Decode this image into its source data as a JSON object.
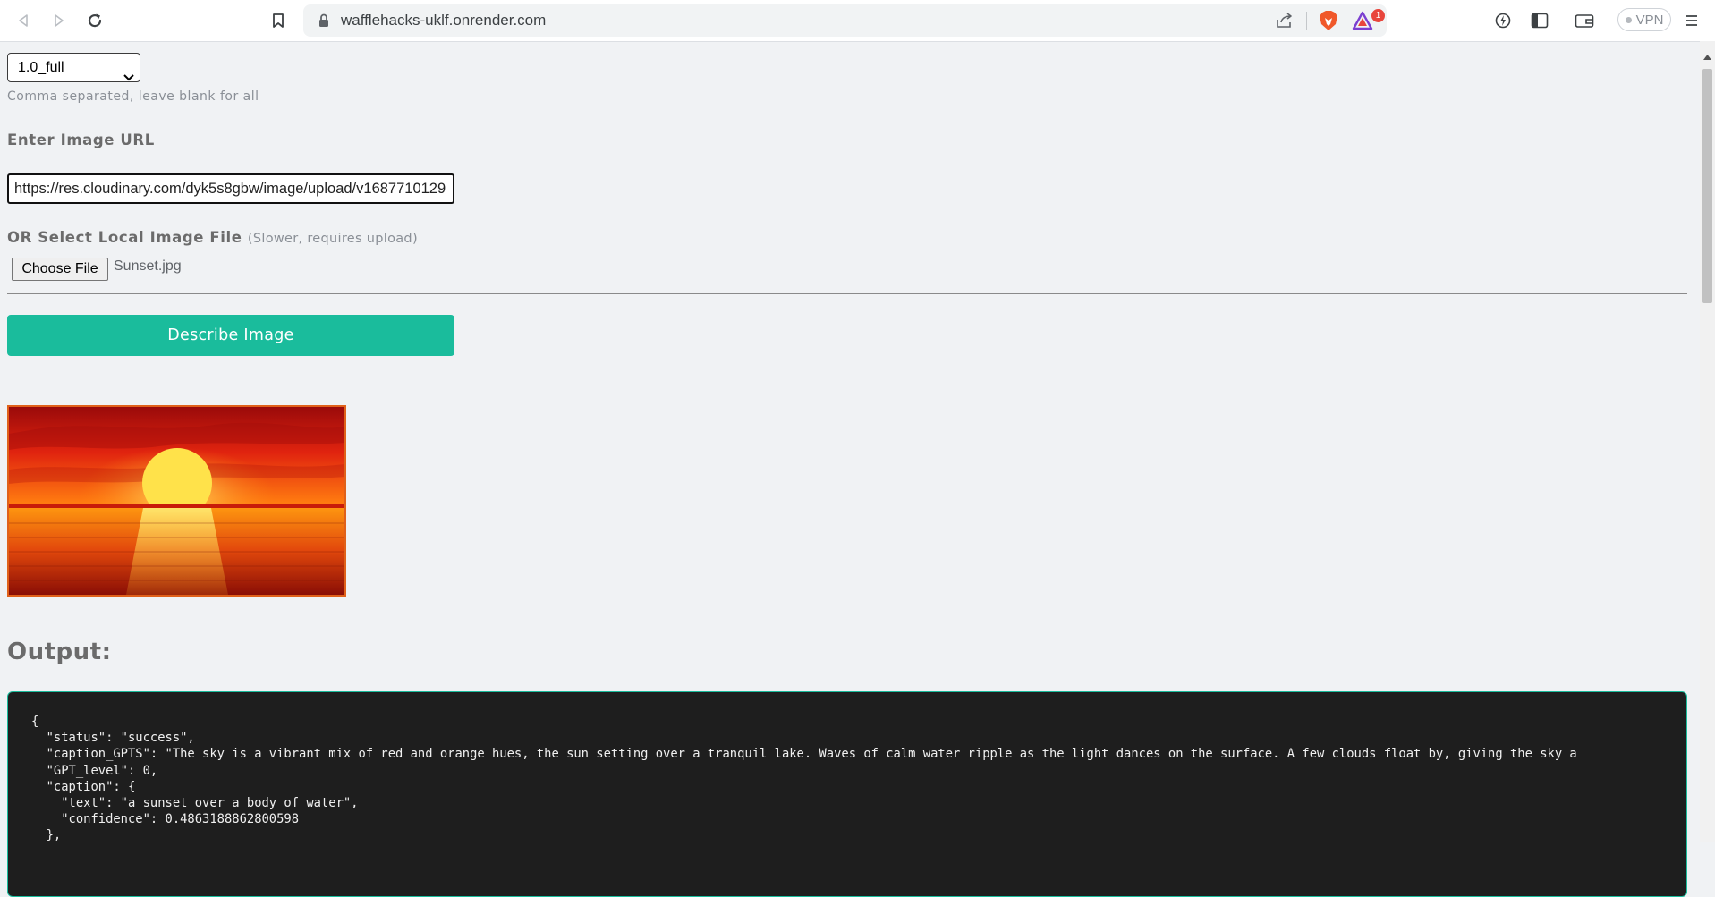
{
  "browser": {
    "url": "wafflehacks-uklf.onrender.com",
    "notification_count": "1",
    "vpn_label": "VPN"
  },
  "form": {
    "model_select_value": "1.0_full",
    "model_hint": "Comma separated, leave blank for all",
    "image_url_label": "Enter Image URL",
    "image_url_value": "https://res.cloudinary.com/dyk5s8gbw/image/upload/v1687710129",
    "local_file_label": "OR Select Local Image File",
    "local_file_note": "(Slower, requires upload)",
    "choose_file_label": "Choose File",
    "file_name": "Sunset.jpg",
    "describe_button_label": "Describe Image"
  },
  "output": {
    "heading": "Output:",
    "json_text": "{\n  \"status\": \"success\",\n  \"caption_GPTS\": \"The sky is a vibrant mix of red and orange hues, the sun setting over a tranquil lake. Waves of calm water ripple as the light dances on the surface. A few clouds float by, giving the sky a\n  \"GPT_level\": 0,\n  \"caption\": {\n    \"text\": \"a sunset over a body of water\",\n    \"confidence\": 0.4863188862800598\n  },"
  },
  "colors": {
    "accent": "#1abc9c",
    "page_bg": "#f0f2f4",
    "output_bg": "#1e1e1e",
    "image_border": "#e0611a"
  },
  "icons": {
    "back": "back-arrow-icon",
    "forward": "forward-arrow-icon",
    "reload": "reload-icon",
    "bookmark": "bookmark-icon",
    "lock": "lock-icon",
    "share": "share-icon",
    "brave": "brave-lion-icon",
    "rewards": "brave-rewards-icon",
    "leo": "leo-icon",
    "sidebar": "sidebar-icon",
    "wallet": "wallet-icon",
    "menu": "menu-icon"
  }
}
